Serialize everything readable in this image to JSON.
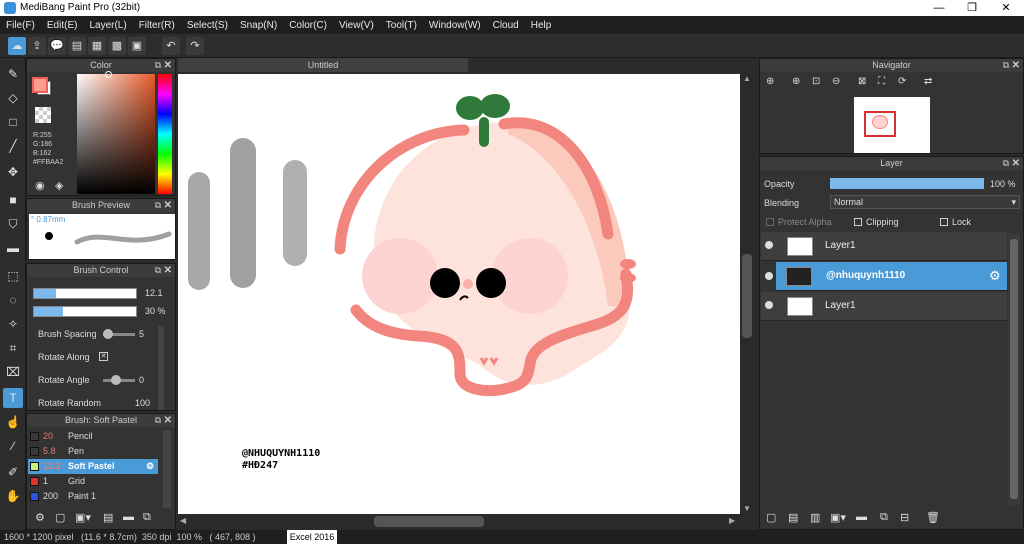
{
  "window": {
    "title": "MediBang Paint Pro (32bit)",
    "minimize": "—",
    "maximize": "❐",
    "close": "✕"
  },
  "menu": [
    "File(F)",
    "Edit(E)",
    "Layer(L)",
    "Filter(R)",
    "Select(S)",
    "Snap(N)",
    "Color(C)",
    "View(V)",
    "Tool(T)",
    "Window(W)",
    "Cloud",
    "Help"
  ],
  "document": {
    "tab_title": "Untitled"
  },
  "color_panel": {
    "title": "Color",
    "values": [
      "R:255",
      "G:186",
      "B:162",
      "#FFBAA2"
    ],
    "primary_color": "#ff9b8f",
    "secondary_color": "#ffffff"
  },
  "brush_preview": {
    "title": "Brush Preview",
    "size": "° 0.87mm"
  },
  "brush_control": {
    "title": "Brush Control",
    "size_value": "12.1",
    "size_fill": 0.22,
    "opacity_value": "30 %",
    "opacity_fill": 0.28,
    "brush_spacing_label": "Brush Spacing",
    "brush_spacing_value": "5",
    "rotate_along_label": "Rotate Along",
    "rotate_angle_label": "Rotate Angle",
    "rotate_angle_value": "0",
    "rotate_random_label": "Rotate Random",
    "rotate_random_value": "100"
  },
  "brush_list": {
    "title": "Brush: Soft Pastel",
    "items": [
      {
        "size": "20",
        "name": "Pencil",
        "color": "#3a3a3a"
      },
      {
        "size": "5.8",
        "name": "Pen",
        "color": "#3a3a3a"
      },
      {
        "size": "12.1",
        "name": "Soft Pastel",
        "color": "#c8f07a"
      },
      {
        "size": "1",
        "name": "Grid",
        "color": "#e03030"
      },
      {
        "size": "200",
        "name": "Paint 1",
        "color": "#3050e0"
      }
    ]
  },
  "navigator": {
    "title": "Navigator"
  },
  "layer_panel": {
    "title": "Layer",
    "opacity_label": "Opacity",
    "opacity_value": "100 %",
    "blending_label": "Blending",
    "blending_value": "Normal",
    "protect_alpha_label": "Protect Alpha",
    "clipping_label": "Clipping",
    "lock_label": "Lock",
    "layers": [
      {
        "name": "Layer1",
        "selected": false
      },
      {
        "name": "@nhuquynh1110",
        "selected": true
      },
      {
        "name": "Layer1",
        "selected": false
      }
    ]
  },
  "canvas_text": {
    "line1": "@NHUQUYNH1110",
    "line2": "#HĐ247"
  },
  "status": {
    "image_info": "1600 * 1200 pixel   (11.6 * 8.7cm)  350 dpi  100 %   ( 467, 808 )",
    "taskbar_item": "Excel 2016"
  },
  "colors": {
    "accent": "#4a9ad8",
    "brush_pink": "#f3857f"
  }
}
